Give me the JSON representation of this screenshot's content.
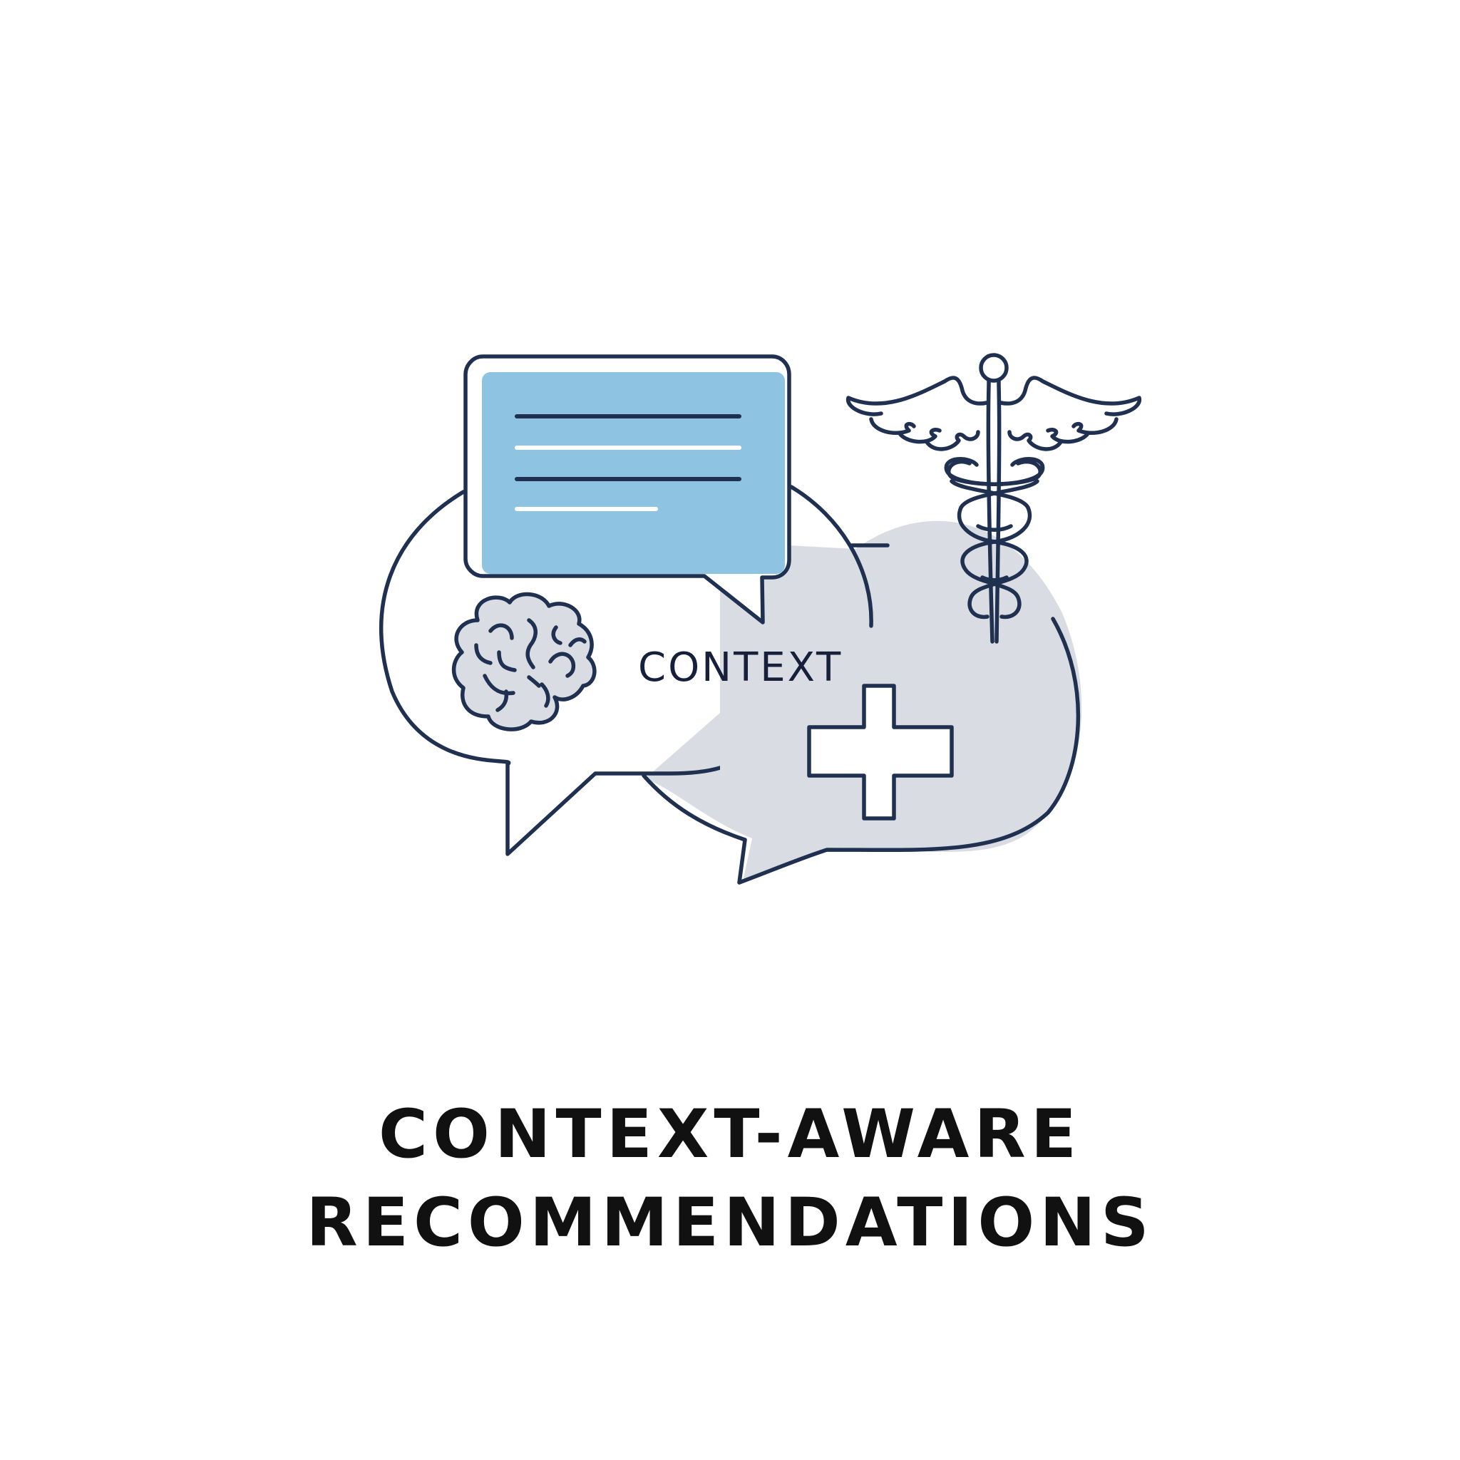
{
  "illustration": {
    "context_label": "CONTEXT",
    "icons": [
      "speech-bubbles-icon",
      "chat-message-icon",
      "brain-icon",
      "caduceus-icon",
      "medical-cross-icon"
    ],
    "colors": {
      "outline": "#1f3050",
      "message_fill": "#8fc3e2",
      "bubble_shade": "#d9dde3",
      "background": "#ffffff"
    }
  },
  "headline": {
    "line1": "CONTEXT-AWARE",
    "line2": "RECOMMENDATIONS"
  }
}
